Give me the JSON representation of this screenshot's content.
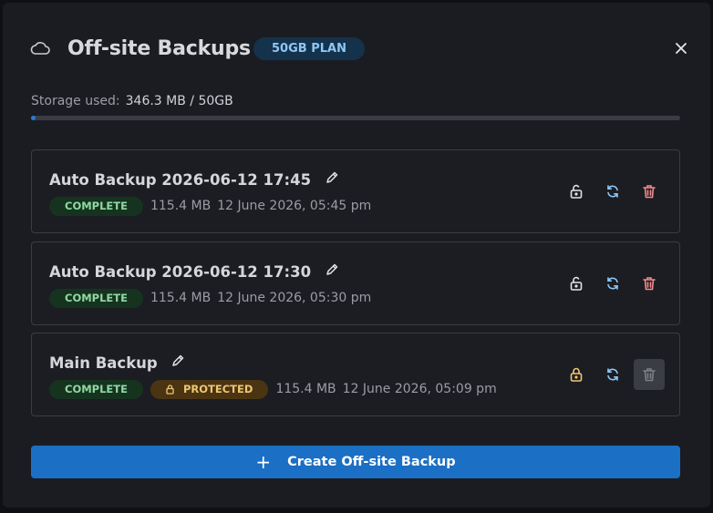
{
  "modal": {
    "title": "Off-site Backups",
    "plan_badge": "50GB PLAN",
    "close_icon": "close-icon",
    "header_icon": "cloud-icon"
  },
  "storage": {
    "label": "Storage used:",
    "value": "346.3 MB / 50GB",
    "fraction_used": 0.0069
  },
  "backups": [
    {
      "name": "Auto Backup 2026-06-12 17:45",
      "status": "COMPLETE",
      "size": "115.4 MB",
      "date": "12 June 2026, 05:45 pm",
      "protected": false
    },
    {
      "name": "Auto Backup 2026-06-12 17:30",
      "status": "COMPLETE",
      "size": "115.4 MB",
      "date": "12 June 2026, 05:30 pm",
      "protected": false
    },
    {
      "name": "Main Backup",
      "status": "COMPLETE",
      "protected_label": "PROTECTED",
      "size": "115.4 MB",
      "date": "12 June 2026, 05:09 pm",
      "protected": true
    }
  ],
  "create_button": {
    "label": "Create Off-site Backup",
    "icon": "plus-icon"
  },
  "colors": {
    "accent": "#1b6fc4",
    "complete": "#8fd9a2",
    "protected": "#f0c673",
    "delete": "#f08c8c",
    "restore": "#8cc8f8"
  }
}
